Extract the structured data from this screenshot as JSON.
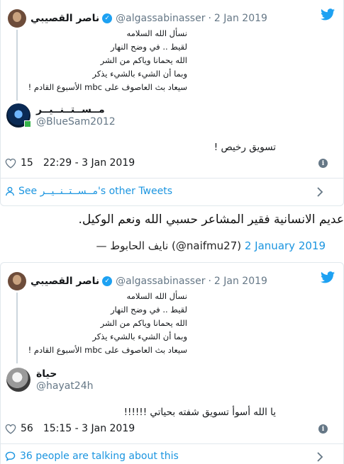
{
  "tweet1": {
    "quoted": {
      "author_name": "ناصر القصيبي",
      "handle": "@algassabinasser",
      "separator": "·",
      "date": "2 Jan 2019",
      "lines": [
        "نسأل الله السلامه",
        "لقيط .. في وضح النهار",
        "الله يحمانا وياكم من الشر",
        "وبما أن الشيء بالشيء يذكر",
        "سيعاد بث العاصوف على mbc الأسبوع القادم !"
      ]
    },
    "reply": {
      "author_name": "مــســتــنــيــر",
      "handle": "@BlueSam2012",
      "text": "تسويق رخيص !"
    },
    "likes": "15",
    "timestamp": "22:29 - 3 Jan 2019",
    "footer_link": "See مــســتــنــيــر's other Tweets"
  },
  "blockquote": {
    "text": "عديم الانسانية فقير المشاعر حسبي الله ونعم الوكيل.",
    "attribution_prefix": "— نايف الحابوط (@naifmu27)",
    "attribution_date": "2 January 2019"
  },
  "tweet2": {
    "quoted": {
      "author_name": "ناصر القصيبي",
      "handle": "@algassabinasser",
      "separator": "·",
      "date": "2 Jan 2019",
      "lines": [
        "نسأل الله السلامه",
        "لقيط .. في وضح النهار",
        "الله يحمانا وياكم من الشر",
        "وبما أن الشيء بالشيء يذكر",
        "سيعاد بث العاصوف على mbc الأسبوع القادم !"
      ]
    },
    "reply": {
      "author_name": "حياة",
      "handle": "@hayat24h",
      "text": "يا الله أسوأ تسويق شفته بحياتي !!!!!!"
    },
    "likes": "56",
    "timestamp": "15:15 - 3 Jan 2019",
    "footer_link": "36 people are talking about this"
  },
  "colors": {
    "link": "#1b95e0",
    "twitter_blue": "#1da1f2",
    "muted": "#657786",
    "border": "#e1e8ed"
  },
  "icons": [
    "twitter-bird-icon",
    "verified-icon",
    "heart-icon",
    "info-icon",
    "person-icon",
    "chat-bubble-icon",
    "chevron-right-icon"
  ]
}
